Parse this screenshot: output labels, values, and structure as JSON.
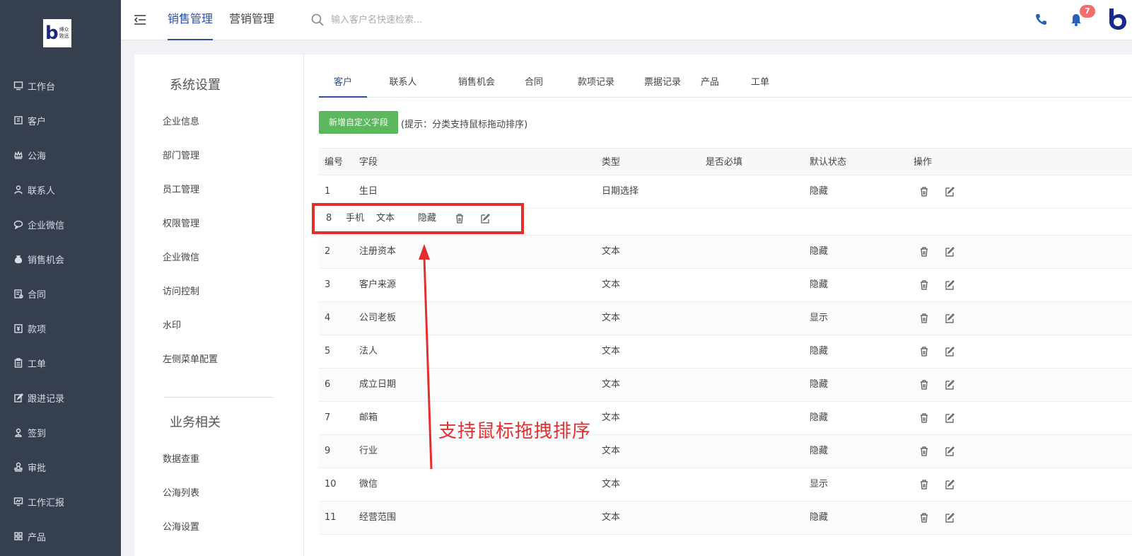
{
  "brand": {
    "logo_text_1": "博众",
    "logo_text_2": "致远"
  },
  "sidebar": {
    "items": [
      {
        "label": "工作台",
        "icon": "desktop-icon"
      },
      {
        "label": "客户",
        "icon": "building-icon"
      },
      {
        "label": "公海",
        "icon": "crown-icon"
      },
      {
        "label": "联系人",
        "icon": "person-icon"
      },
      {
        "label": "企业微信",
        "icon": "chat-icon"
      },
      {
        "label": "销售机会",
        "icon": "moneybag-icon"
      },
      {
        "label": "合同",
        "icon": "contract-icon"
      },
      {
        "label": "款项",
        "icon": "payment-icon"
      },
      {
        "label": "工单",
        "icon": "clipboard-icon"
      },
      {
        "label": "跟进记录",
        "icon": "pen-icon"
      },
      {
        "label": "签到",
        "icon": "location-icon"
      },
      {
        "label": "审批",
        "icon": "stamp-icon"
      },
      {
        "label": "工作汇报",
        "icon": "report-icon"
      },
      {
        "label": "产品",
        "icon": "grid-icon"
      }
    ]
  },
  "topbar": {
    "tabs": [
      {
        "label": "销售管理"
      },
      {
        "label": "营销管理"
      }
    ],
    "search_placeholder": "输入客户名快速检索...",
    "notification_count": "7"
  },
  "settings": {
    "section1_title": "系统设置",
    "section1_items": [
      "企业信息",
      "部门管理",
      "员工管理",
      "权限管理",
      "企业微信",
      "访问控制",
      "水印",
      "左侧菜单配置"
    ],
    "section2_title": "业务相关",
    "section2_items": [
      "数据查重",
      "公海列表",
      "公海设置"
    ]
  },
  "tabs": [
    "客户",
    "联系人",
    "销售机会",
    "合同",
    "款项记录",
    "票据记录",
    "产品",
    "工单"
  ],
  "add_button": "新增自定义字段",
  "hint": "(提示：分类支持鼠标拖动排序)",
  "table": {
    "headers": [
      "编号",
      "字段",
      "类型",
      "是否必填",
      "默认状态",
      "操作"
    ],
    "rows": [
      {
        "no": "1",
        "field": "生日",
        "type": "日期选择",
        "state": "隐藏"
      },
      {
        "no": "2",
        "field": "注册资本",
        "type": "文本",
        "state": "隐藏"
      },
      {
        "no": "3",
        "field": "客户来源",
        "type": "文本",
        "state": "隐藏"
      },
      {
        "no": "4",
        "field": "公司老板",
        "type": "文本",
        "state": "显示"
      },
      {
        "no": "5",
        "field": "法人",
        "type": "文本",
        "state": "隐藏"
      },
      {
        "no": "6",
        "field": "成立日期",
        "type": "文本",
        "state": "隐藏"
      },
      {
        "no": "7",
        "field": "邮箱",
        "type": "文本",
        "state": "隐藏"
      },
      {
        "no": "9",
        "field": "行业",
        "type": "文本",
        "state": "隐藏"
      },
      {
        "no": "10",
        "field": "微信",
        "type": "文本",
        "state": "显示"
      },
      {
        "no": "11",
        "field": "经营范围",
        "type": "文本",
        "state": "隐藏"
      }
    ]
  },
  "dragging_row": {
    "no": "8",
    "field": "手机",
    "type": "文本",
    "state": "隐藏"
  },
  "annotation": "支持鼠标拖拽排序",
  "colors": {
    "sidebar": "#353f4e",
    "accent": "#2c4ea3",
    "add_button": "#5cb85c",
    "annotation": "#e32e2e",
    "badge": "#f56c6c"
  }
}
